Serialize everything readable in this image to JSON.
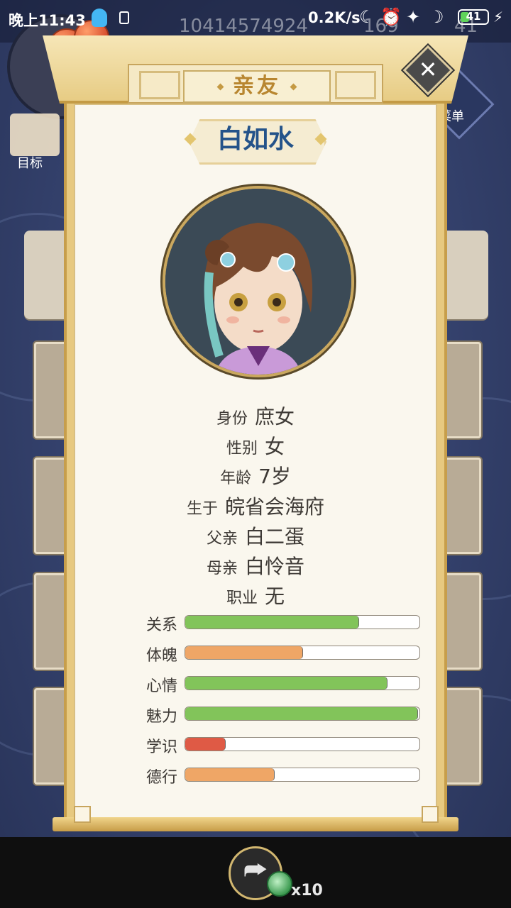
{
  "status_bar": {
    "time": "晚上11:43",
    "net_speed": "0.2K/s",
    "battery": "41",
    "battery_level": 0.41
  },
  "background": {
    "currency_1": "10414574924",
    "currency_2": "169",
    "currency_3": "41",
    "goal_label": "目标",
    "menu_label": "菜单"
  },
  "panel": {
    "title": "亲友",
    "name": "白如水"
  },
  "profile": [
    {
      "key": "身份",
      "value": "庶女"
    },
    {
      "key": "性别",
      "value": "女"
    },
    {
      "key": "年龄",
      "value": "7岁"
    },
    {
      "key": "生于",
      "value": "皖省会海府"
    },
    {
      "key": "父亲",
      "value": "白二蛋"
    },
    {
      "key": "母亲",
      "value": "白怜音"
    },
    {
      "key": "职业",
      "value": "无"
    }
  ],
  "stats": [
    {
      "label": "关系",
      "fraction": 0.74,
      "color": "#82c45a"
    },
    {
      "label": "体魄",
      "fraction": 0.5,
      "color": "#efa666"
    },
    {
      "label": "心情",
      "fraction": 0.86,
      "color": "#82c45a"
    },
    {
      "label": "魅力",
      "fraction": 0.99,
      "color": "#82c45a"
    },
    {
      "label": "学识",
      "fraction": 0.17,
      "color": "#df5a45"
    },
    {
      "label": "德行",
      "fraction": 0.38,
      "color": "#efa666"
    }
  ],
  "footer": {
    "reward_count": "x10"
  },
  "icons": {
    "close": "close-icon",
    "share": "share-icon",
    "reward": "coin-icon"
  }
}
